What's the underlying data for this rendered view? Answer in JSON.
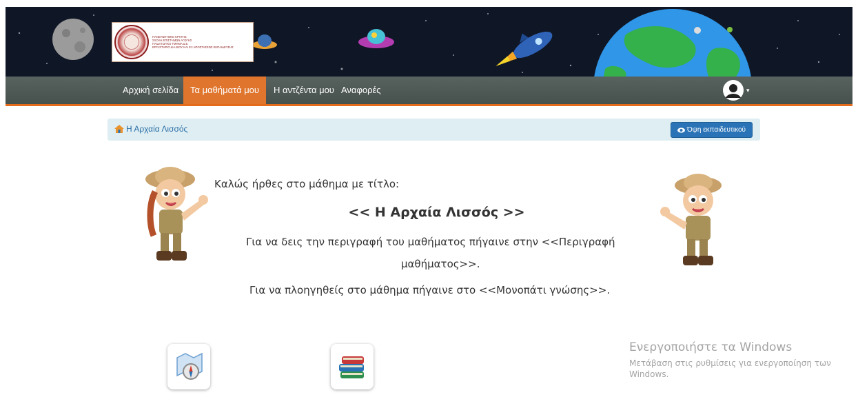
{
  "logo": {
    "lines": [
      "ΠΑΝΕΠΙΣΤΗΜΙΟ ΚΡΗΤΗΣ",
      "ΣΧΟΛΗ ΕΠΙΣΤΗΜΩΝ ΑΓΩΓΗΣ",
      "ΠΑΙΔΑΓΩΓΙΚΟ ΤΜΗΜΑ Δ.Ε.",
      "ΕΡΓΑΣΤΗΡΙΟ ΔΙΑ ΒΙΟΥ ΚΑΙ ΕΞ ΑΠΟΣΤΑΣΕΩΣ ΕΚΠΑΙΔΕΥΣΗΣ"
    ]
  },
  "nav": {
    "items": [
      {
        "label": "Αρχική σελίδα",
        "active": false
      },
      {
        "label": "Τα μαθήματά μου",
        "active": true
      },
      {
        "label": "Η αντζέντα μου",
        "active": false
      },
      {
        "label": "Αναφορές",
        "active": false
      }
    ],
    "user_icon": "user-avatar-icon",
    "user_caret": "▾"
  },
  "breadcrumb": {
    "icon": "home-icon",
    "label": "Η Αρχαία Λισσός"
  },
  "teacher_view_button": {
    "icon": "eye-icon",
    "label": "Όψη εκπαιδευτικού"
  },
  "welcome": {
    "intro": "Καλώς ήρθες στο μάθημα με τίτλο:",
    "course_title": "<< Η Αρχαία Λισσός >>",
    "description_line1": "Για να δεις την περιγραφή του μαθήματος πήγαινε στην <<Περιγραφή",
    "description_line2": "μαθήματος>>.",
    "path_line": "Για να πλοηγηθείς στο μάθημα πήγαινε στο <<Μονοπάτι γνώσης>>."
  },
  "tiles": [
    {
      "icon": "compass-map-icon"
    },
    {
      "icon": "books-icon"
    }
  ],
  "windows_watermark": {
    "title": "Ενεργοποιήστε τα Windows",
    "subtitle": "Μετάβαση στις ρυθμίσεις για ενεργοποίηση των Windows."
  },
  "colors": {
    "nav_bg": "#4f5956",
    "nav_active": "#e0762e",
    "nav_border": "#e46a1c",
    "crumb_bg": "#dfeef2",
    "button_blue": "#2a73b6"
  }
}
